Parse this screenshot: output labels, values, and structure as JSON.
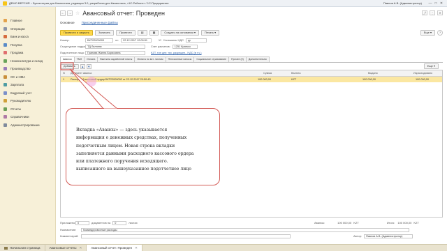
{
  "window": {
    "title": "ДЕМО ВЕРСИЯ :: Бухгалтерия для Казахстана, редакция 3.0, разработка для Казахстана, «1С-Рейтинг» / 1С:Предприятие",
    "user": "Павлов А.В. (Администратор)",
    "controls": [
      "—",
      "□",
      "✕"
    ]
  },
  "sidebar": {
    "items": [
      {
        "label": "Главное",
        "color": "#e3a24c"
      },
      {
        "label": "Операции",
        "color": "#8a94a8"
      },
      {
        "label": "Банк и касса",
        "color": "#d66b3d"
      },
      {
        "label": "Покупка",
        "color": "#5a8bc7"
      },
      {
        "label": "Продажа",
        "color": "#e06f6f"
      },
      {
        "label": "Номенклатура и склад",
        "color": "#6aa35a"
      },
      {
        "label": "Производство",
        "color": "#9b7bb8"
      },
      {
        "label": "ОС и НМА",
        "color": "#c98e3a"
      },
      {
        "label": "Зарплата",
        "color": "#4f9ca3"
      },
      {
        "label": "Кадровый учет",
        "color": "#7b8fc9"
      },
      {
        "label": "Руководителю",
        "color": "#d0a03a"
      },
      {
        "label": "Отчеты",
        "color": "#6b9e57"
      },
      {
        "label": "Справочники",
        "color": "#b07aa6"
      },
      {
        "label": "Администрирование",
        "color": "#7f8a9c"
      }
    ]
  },
  "header": {
    "back": "←",
    "forward": "→",
    "star": "☆",
    "title": "Авансовый отчет: Проведен",
    "right_buttons": [
      "⤴",
      "⋮",
      "✕"
    ]
  },
  "tabs": {
    "main": "Основное",
    "attached": "Присоединенные файлы"
  },
  "toolbar": {
    "post_close": "Провести и закрыть",
    "save": "Записать",
    "post": "Провести",
    "icon1": "▤",
    "icon2": "▦",
    "create_based": "Создать на основании ▾",
    "print": "Печать ▾",
    "more": "Еще ▾",
    "help": "?"
  },
  "form": {
    "number_label": "Номер:",
    "number_value": "БКТ22000003",
    "date_label": "от:",
    "date_value": "22.12.2017 12:09:51",
    "nds_label": "Учитывать НДС",
    "currency_value": "ру",
    "unit_label": "Структурное подразд.:",
    "unit_value": "ТД Лилпенк",
    "account_label": "Счет расчетов:",
    "account_value": "1251 Краткос",
    "person_label": "Подотчетное лицо:",
    "person_value": "Грапова Жанна Борисовна",
    "price_type": "KZT, тип цен: тек. разрешен., НДС (в т.ч.)"
  },
  "doc_tabs": [
    "Авансы",
    "ТМЗ",
    "Оплата",
    "Выплата заработной платы",
    "Оплата по вст. листам",
    "Пенсионные взносы",
    "Социальное страхование",
    "Прочее (2)",
    "Дополнительно"
  ],
  "subbar": {
    "add": "Добавить",
    "up": "▲",
    "down": "▼",
    "more": "Еще ▾"
  },
  "grid": {
    "headers": {
      "num": "N",
      "doc": "Документ аванса",
      "sum": "Сумма",
      "currency": "Валюта",
      "issued": "Выдано",
      "spent": "Израсходовано"
    },
    "rows": [
      {
        "num": "1",
        "doc": "Расходный кассовый ордер БКТ22000002 от 22.12.2017 20:50:43",
        "sum": "100 000,00",
        "currency": "KZT",
        "issued": "100 000,00",
        "spent": "100 000,00"
      }
    ]
  },
  "callout": {
    "lines": [
      "Вкладка «Авансы» — здесь указывается",
      "информация о денежных средствах, полученных",
      "подотчетным лицом. Новая строка вкладки",
      "заполняется данными расходного кассового ордера",
      "или платежного поручения исходящего.",
      "выписанного на вышеуказанное подотчетное лицо"
    ],
    "color": "#d35a55"
  },
  "footer": {
    "attached_label": "Приложено:",
    "attached_value": "0",
    "docs_label": "документов на",
    "docs_value": "0",
    "pages_label": "листах",
    "advances_label": "Авансы:",
    "advances_value": "100 000,00",
    "advances_cur": "KZT",
    "total_label": "Итого:",
    "total_value": "100 000,00",
    "total_cur": "KZT",
    "purpose_label": "Назначение:",
    "purpose_value": "Командировочные расходы",
    "comment_label": "Комментарий:",
    "author_label": "Автор:",
    "author_value": "Павлов А.В. (Администратор)"
  },
  "taskbar": {
    "home": "Начальная страница",
    "tab1": "Авансовые отчеты",
    "tab2": "Авансовый отчет: Проведен",
    "close": "✕"
  }
}
